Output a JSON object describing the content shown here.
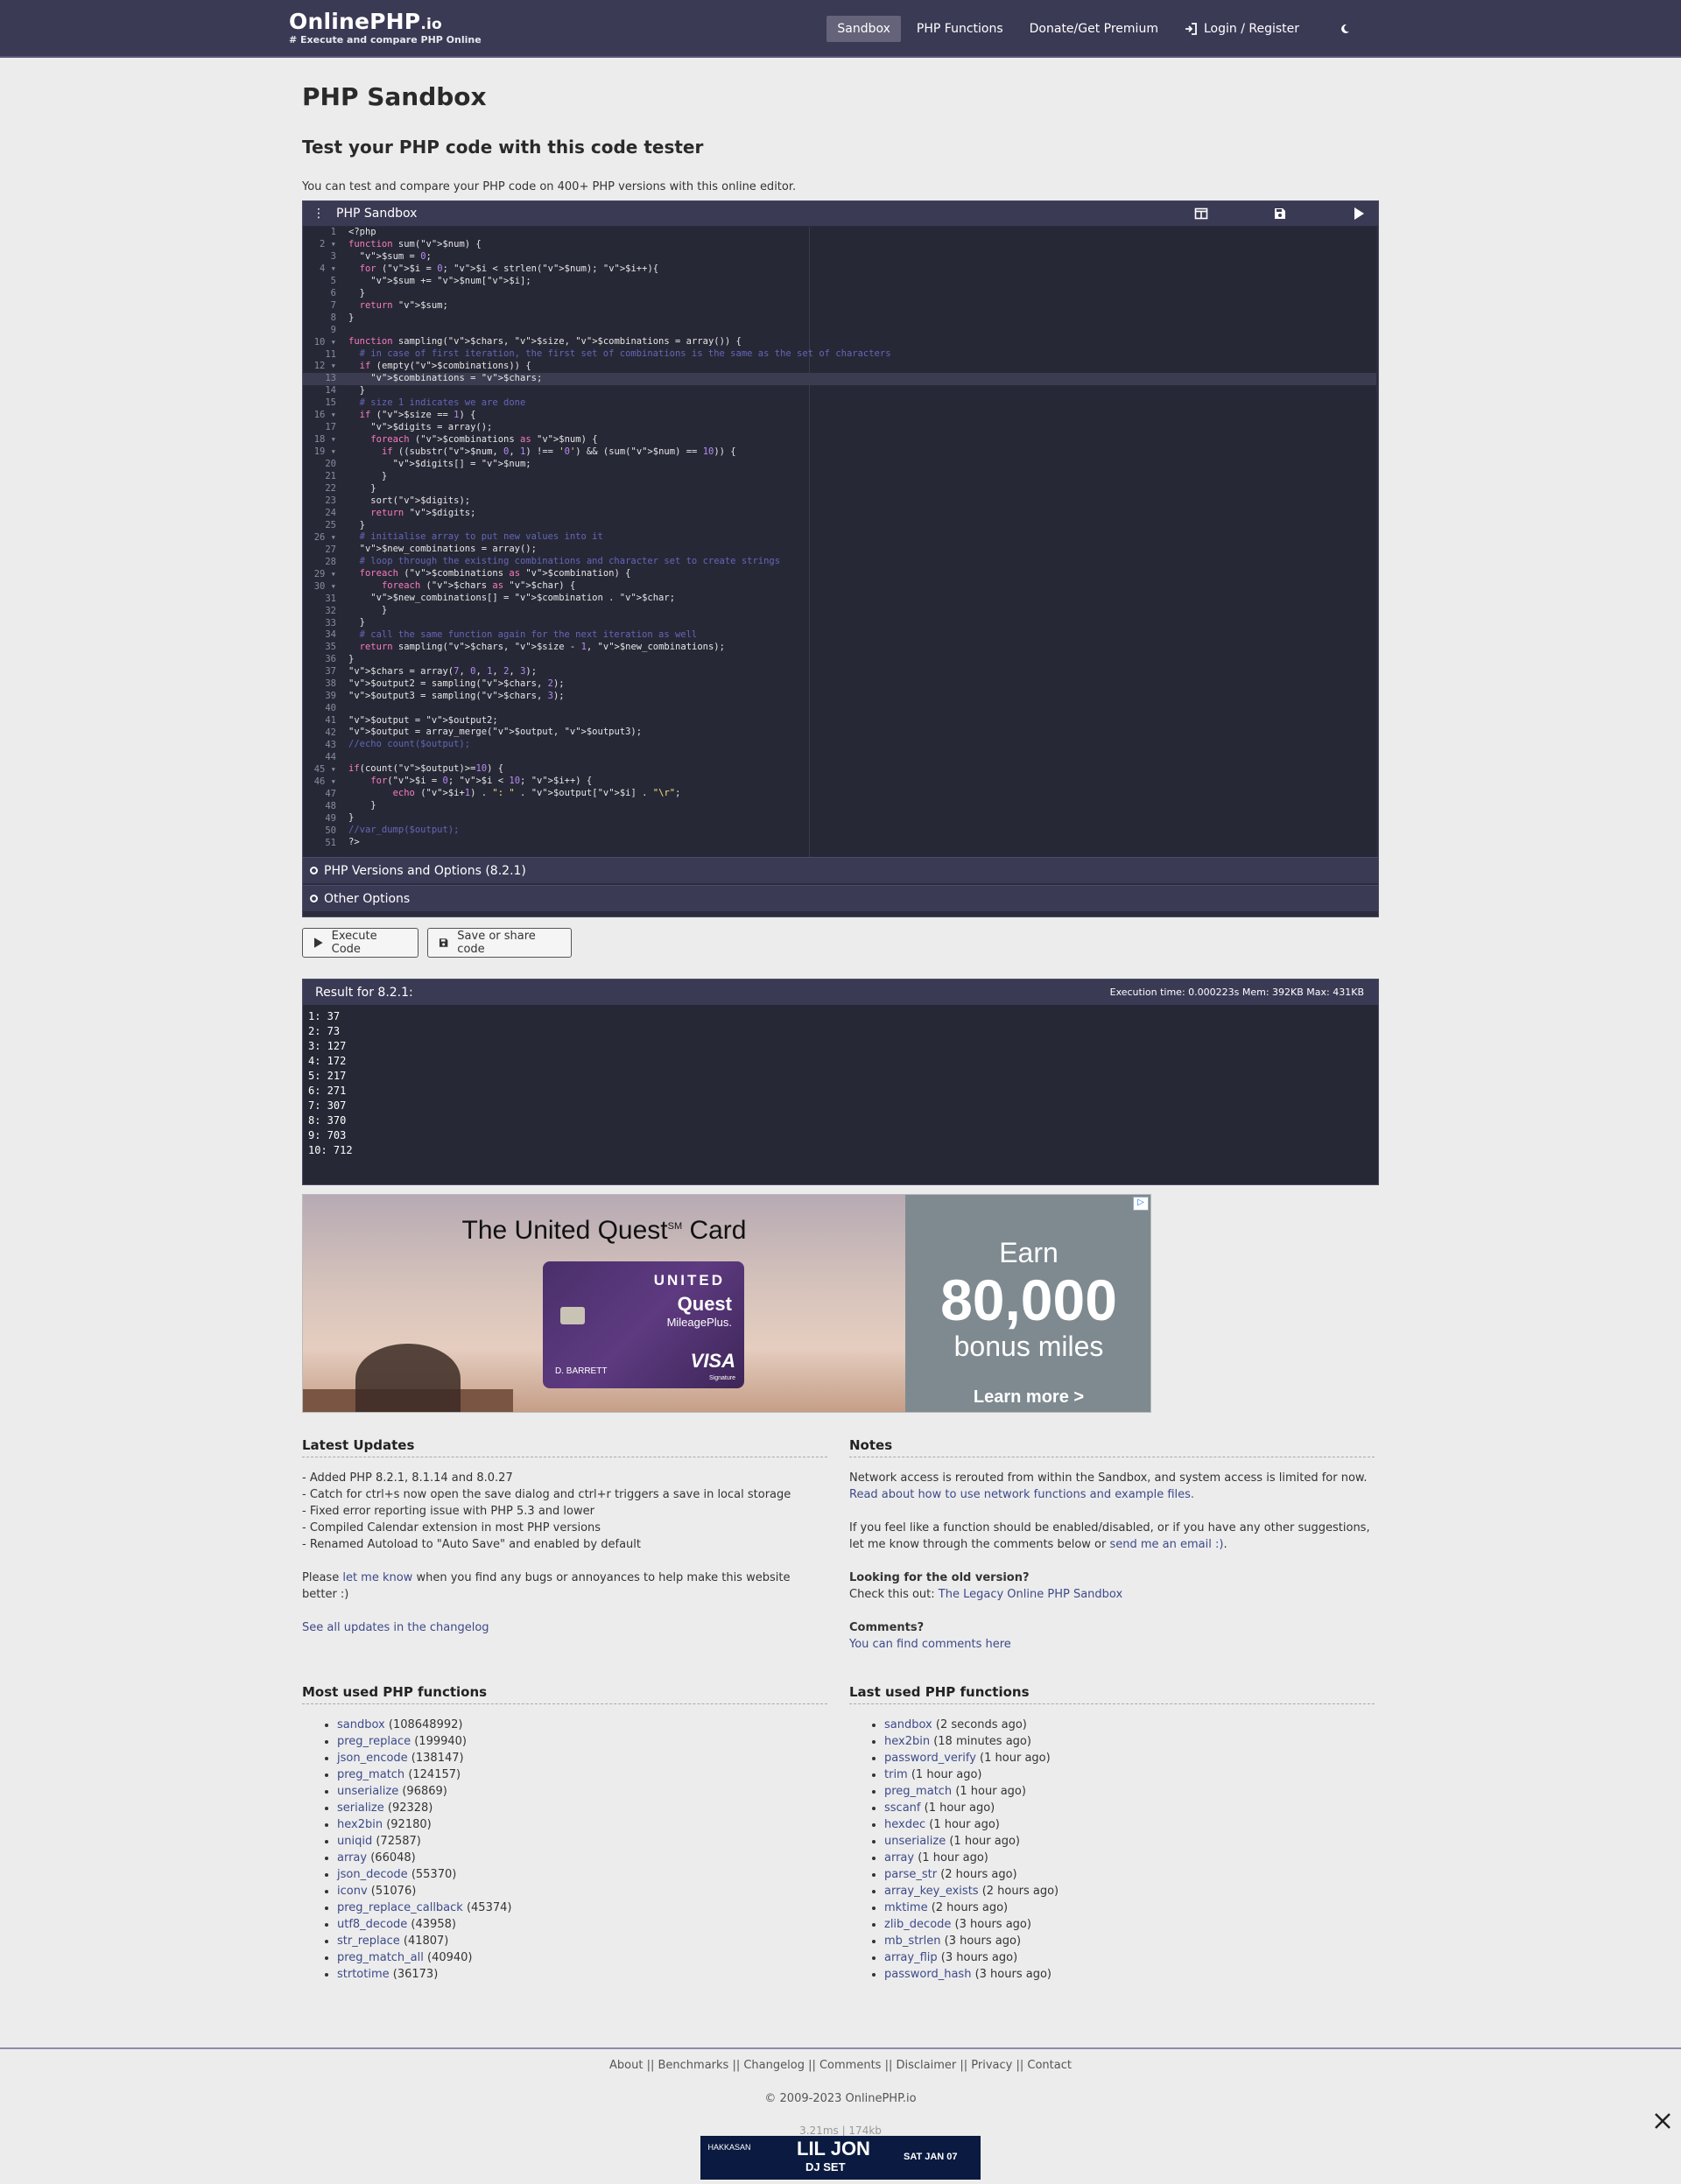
{
  "navbar": {
    "brand_name": "OnlinePHP",
    "brand_suffix": ".io",
    "brand_tagline": "# Execute and compare PHP Online",
    "items": [
      {
        "label": "Sandbox",
        "active": true
      },
      {
        "label": "PHP Functions"
      },
      {
        "label": "Donate/Get Premium"
      },
      {
        "label": "Login / Register",
        "icon": "login-icon"
      }
    ],
    "theme_icon": "moon-icon"
  },
  "page": {
    "title": "PHP Sandbox",
    "subtitle": "Test your PHP code with this code tester",
    "intro": "You can test and compare your PHP code on 400+ PHP versions with this online editor."
  },
  "editor": {
    "title": "PHP Sandbox",
    "tool_icons": [
      "split-view-icon",
      "save-icon",
      "run-icon"
    ],
    "line_numbers": [
      "1",
      "2",
      "3",
      "4",
      "5",
      "6",
      "7",
      "8",
      "9",
      "10",
      "11",
      "12",
      "13",
      "14",
      "15",
      "16",
      "17",
      "18",
      "19",
      "20",
      "21",
      "22",
      "23",
      "24",
      "25",
      "26",
      "27",
      "28",
      "29",
      "30",
      "31",
      "32",
      "33",
      "34",
      "35",
      "36",
      "37",
      "38",
      "39",
      "40",
      "41",
      "42",
      "43",
      "44",
      "45",
      "46",
      "47",
      "48",
      "49",
      "50",
      "51"
    ],
    "fold_markers": [
      "2",
      "4",
      "10",
      "12",
      "16",
      "18",
      "19",
      "26",
      "29",
      "30",
      "45",
      "46"
    ],
    "lines": [
      "<?php",
      "function sum($num) {",
      "  $sum = 0;",
      "  for ($i = 0; $i < strlen($num); $i++){",
      "    $sum += $num[$i];",
      "  }",
      "  return $sum;",
      "}",
      "",
      "function sampling($chars, $size, $combinations = array()) {",
      "  # in case of first iteration, the first set of combinations is the same as the set of characters",
      "  if (empty($combinations)) {",
      "    $combinations = $chars;",
      "  }",
      "  # size 1 indicates we are done",
      "  if ($size == 1) {",
      "    $digits = array();",
      "    foreach ($combinations as $num) {",
      "      if ((substr($num, 0, 1) !== '0') && (sum($num) == 10)) {",
      "        $digits[] = $num;",
      "      }",
      "    }",
      "    sort($digits);",
      "    return $digits;",
      "  }",
      "  # initialise array to put new values into it",
      "  $new_combinations = array();",
      "  # loop through the existing combinations and character set to create strings",
      "  foreach ($combinations as $combination) {",
      "      foreach ($chars as $char) {",
      "    $new_combinations[] = $combination . $char;",
      "      }",
      "  }",
      "  # call the same function again for the next iteration as well",
      "  return sampling($chars, $size - 1, $new_combinations);",
      "}",
      "$chars = array(7, 0, 1, 2, 3);",
      "$output2 = sampling($chars, 2);",
      "$output3 = sampling($chars, 3);",
      "",
      "$output = $output2;",
      "$output = array_merge($output, $output3);",
      "//echo count($output);",
      "",
      "if(count($output)>=10) {",
      "    for($i = 0; $i < 10; $i++) {",
      "        echo ($i+1) . \": \" . $output[$i] . \"\\r\";",
      "    }",
      "}",
      "//var_dump($output);",
      "?>"
    ],
    "versions_label": "PHP Versions and Options (8.2.1)",
    "other_options_label": "Other Options"
  },
  "buttons": {
    "execute": "Execute Code",
    "save": "Save or share code"
  },
  "result": {
    "title": "Result for 8.2.1:",
    "stats": "Execution time: 0.000223s Mem: 392KB Max: 431KB",
    "output": "1: 37\n2: 73\n3: 127\n4: 172\n5: 217\n6: 271\n7: 307\n8: 370\n9: 703\n10: 712"
  },
  "ad": {
    "title": "The United Quest",
    "title_mark": "SM",
    "title_suffix": " Card",
    "card_brand": "UNITED",
    "card_product": "Quest",
    "card_program": "MileagePlus.",
    "card_holder": "D. BARRETT",
    "card_network": "VISA",
    "card_signature": "Signature",
    "earn": "Earn",
    "miles": "80,000",
    "bonus": "bonus miles",
    "cta": "Learn more >"
  },
  "latest_updates": {
    "title": "Latest Updates",
    "items": [
      "- Added PHP 8.2.1, 8.1.14 and 8.0.27",
      "- Catch for ctrl+s now open the save dialog and ctrl+r triggers a save in local storage",
      "- Fixed error reporting issue with PHP 5.3 and lower",
      "- Compiled Calendar extension in most PHP versions",
      "- Renamed Autoload to \"Auto Save\" and enabled by default"
    ],
    "bugs_prefix": "Please ",
    "bugs_link": "let me know",
    "bugs_suffix": " when you find any bugs or annoyances to help make this website better :)",
    "changelog_link": "See all updates in the changelog"
  },
  "notes": {
    "title": "Notes",
    "network_text": "Network access is rerouted from within the Sandbox, and system access is limited for now. ",
    "network_link": "Read about how to use network functions and example files.",
    "function_text": "If you feel like a function should be enabled/disabled, or if you have any other suggestions, let me know through the comments below or ",
    "function_link": "send me an email :)",
    "function_end": ".",
    "old_heading": "Looking for the old version?",
    "old_text": "Check this out: ",
    "old_link": "The Legacy Online PHP Sandbox",
    "comments_heading": "Comments?",
    "comments_link": "You can find comments here"
  },
  "most_used": {
    "title": "Most used PHP functions",
    "items": [
      {
        "name": "sandbox",
        "count": " (108648992)"
      },
      {
        "name": "preg_replace",
        "count": " (199940)"
      },
      {
        "name": "json_encode",
        "count": " (138147)"
      },
      {
        "name": "preg_match",
        "count": " (124157)"
      },
      {
        "name": "unserialize",
        "count": " (96869)"
      },
      {
        "name": "serialize",
        "count": " (92328)"
      },
      {
        "name": "hex2bin",
        "count": " (92180)"
      },
      {
        "name": "uniqid",
        "count": " (72587)"
      },
      {
        "name": "array",
        "count": " (66048)"
      },
      {
        "name": "json_decode",
        "count": " (55370)"
      },
      {
        "name": "iconv",
        "count": " (51076)"
      },
      {
        "name": "preg_replace_callback",
        "count": " (45374)"
      },
      {
        "name": "utf8_decode",
        "count": " (43958)"
      },
      {
        "name": "str_replace",
        "count": " (41807)"
      },
      {
        "name": "preg_match_all",
        "count": " (40940)"
      },
      {
        "name": "strtotime",
        "count": " (36173)"
      }
    ]
  },
  "last_used": {
    "title": "Last used PHP functions",
    "items": [
      {
        "name": "sandbox",
        "ago": " (2 seconds ago)"
      },
      {
        "name": "hex2bin",
        "ago": " (18 minutes ago)"
      },
      {
        "name": "password_verify",
        "ago": " (1 hour ago)"
      },
      {
        "name": "trim",
        "ago": " (1 hour ago)"
      },
      {
        "name": "preg_match",
        "ago": " (1 hour ago)"
      },
      {
        "name": "sscanf",
        "ago": " (1 hour ago)"
      },
      {
        "name": "hexdec",
        "ago": " (1 hour ago)"
      },
      {
        "name": "unserialize",
        "ago": " (1 hour ago)"
      },
      {
        "name": "array",
        "ago": " (1 hour ago)"
      },
      {
        "name": "parse_str",
        "ago": " (2 hours ago)"
      },
      {
        "name": "array_key_exists",
        "ago": " (2 hours ago)"
      },
      {
        "name": "mktime",
        "ago": " (2 hours ago)"
      },
      {
        "name": "zlib_decode",
        "ago": " (3 hours ago)"
      },
      {
        "name": "mb_strlen",
        "ago": " (3 hours ago)"
      },
      {
        "name": "array_flip",
        "ago": " (3 hours ago)"
      },
      {
        "name": "password_hash",
        "ago": " (3 hours ago)"
      }
    ]
  },
  "footer": {
    "links": [
      "About",
      "Benchmarks",
      "Changelog",
      "Comments",
      "Disclaimer",
      "Privacy",
      "Contact"
    ],
    "separator": " || ",
    "copyright": "© 2009-2023 OnlinePHP.io",
    "timing": "3.21ms | 174kb"
  },
  "bottom_ad": {
    "logo": "HAKKASAN",
    "headline": "LIL JON",
    "sub": "DJ SET",
    "date": "SAT JAN 07"
  },
  "colors": {
    "navbar": "#3b3a55",
    "editor_bg": "#272836",
    "link": "#3d4a8a"
  }
}
